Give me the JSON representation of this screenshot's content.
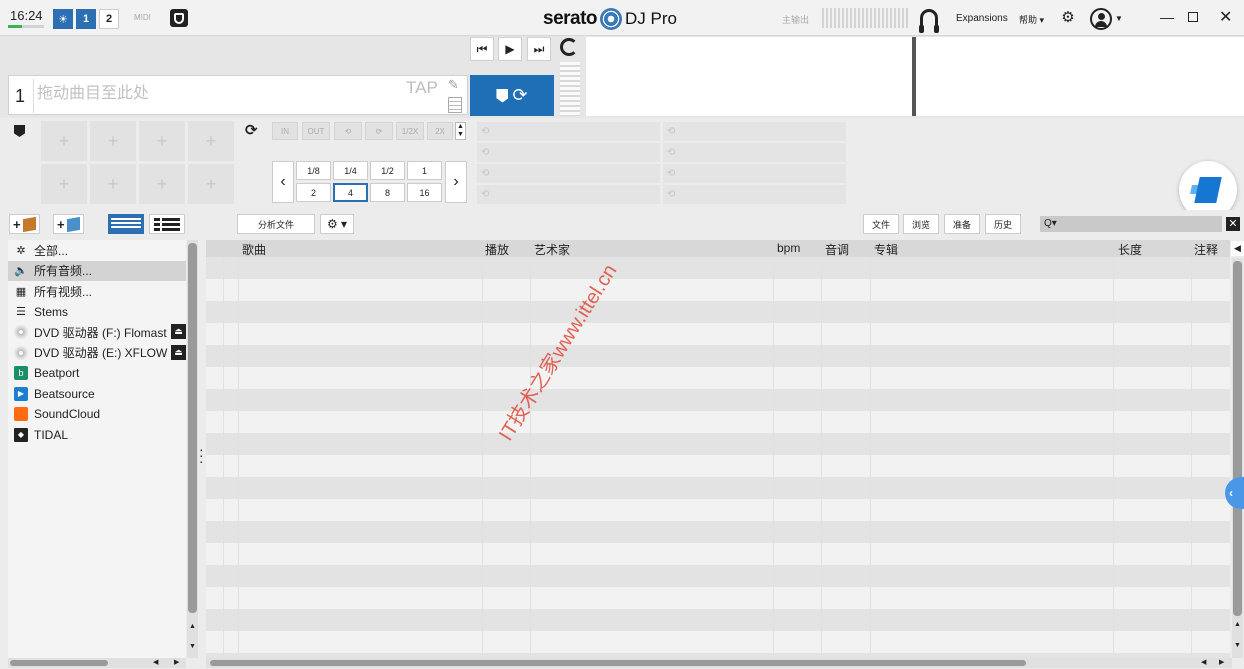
{
  "topbar": {
    "time": "16:24",
    "deck_buttons": [
      "1",
      "2"
    ],
    "midi": "MIDI",
    "logo_word": "serato",
    "logo_product": "DJ Pro",
    "master_label": "主输出",
    "expansions": "Expansions",
    "help": "帮助 ▾",
    "icons": [
      "sun-icon",
      "shield-icon",
      "headphones-icon",
      "gear-icon",
      "user-icon",
      "minimize-icon",
      "restore-icon",
      "close-icon"
    ]
  },
  "deck": {
    "number": "1",
    "drop_hint": "拖动曲目至此处",
    "tap": "TAP"
  },
  "loops": {
    "controls": [
      "IN",
      "OUT",
      "⟲",
      "⟳",
      "1/2X",
      "2X"
    ],
    "beat_values_top": [
      "1/8",
      "1/4",
      "1/2",
      "1"
    ],
    "beat_values_bottom": [
      "2",
      "4",
      "8",
      "16"
    ],
    "selected_beat": "4"
  },
  "library": {
    "analyze_button": "分析文件",
    "panel_buttons": [
      "文件",
      "浏览",
      "准备",
      "历史"
    ],
    "search_placeholder": "Q▾",
    "sidebar": [
      {
        "label": "全部...",
        "icon": "asterisk-icon"
      },
      {
        "label": "所有音频...",
        "icon": "speaker-icon"
      },
      {
        "label": "所有视频...",
        "icon": "film-icon"
      },
      {
        "label": "Stems",
        "icon": "stems-icon"
      },
      {
        "label": "DVD 驱动器 (F:) Flomast",
        "icon": "cd-icon"
      },
      {
        "label": "DVD 驱动器 (E:) XFLOW",
        "icon": "cd-icon"
      },
      {
        "label": "Beatport",
        "icon": "beatport-icon"
      },
      {
        "label": "Beatsource",
        "icon": "beatsource-icon"
      },
      {
        "label": "SoundCloud",
        "icon": "soundcloud-icon"
      },
      {
        "label": "TIDAL",
        "icon": "tidal-icon"
      }
    ],
    "columns": [
      "歌曲",
      "播放",
      "艺术家",
      "bpm",
      "音调",
      "专辑",
      "长度",
      "注释"
    ]
  },
  "watermark": "IT技术之家www.ittel.cn",
  "colors": {
    "accent": "#2c6fb3",
    "sync": "#1e6fb5",
    "watermark": "#e04a3a"
  }
}
